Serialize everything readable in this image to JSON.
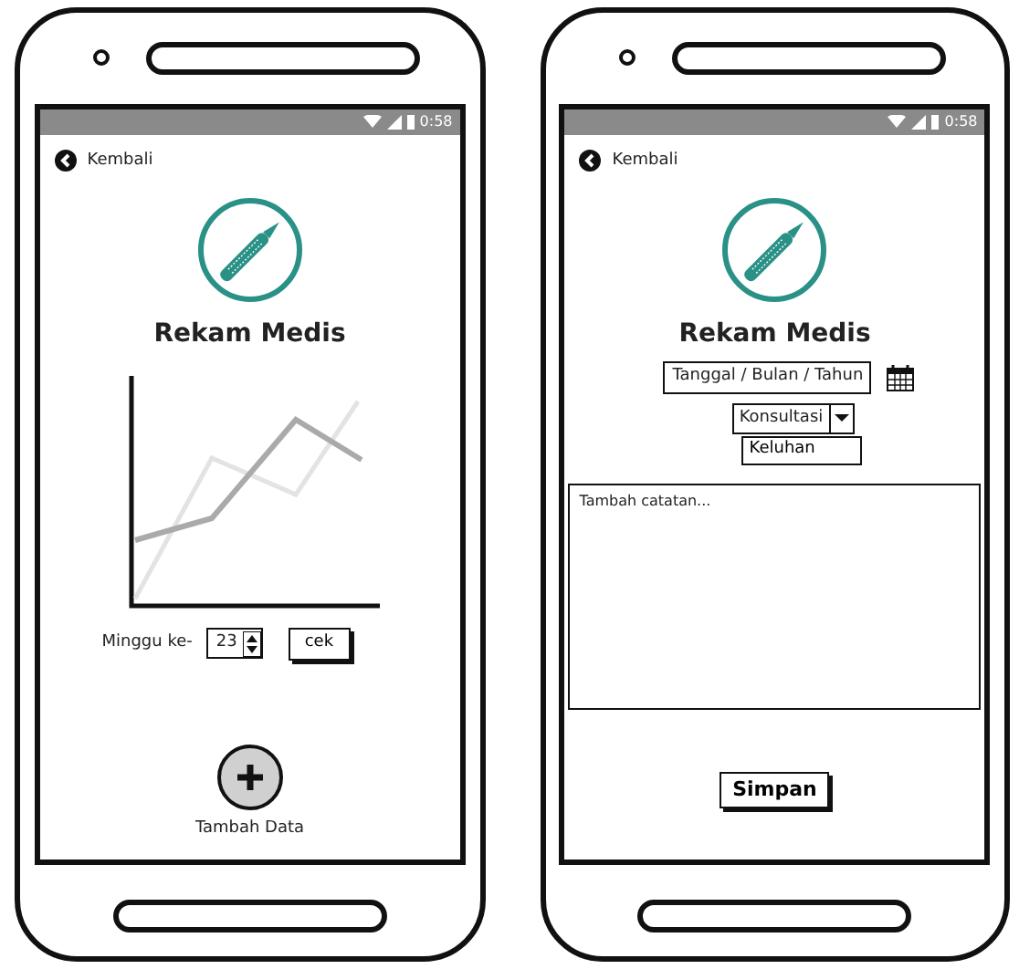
{
  "phones": [
    {
      "kind": "chart",
      "status_time": "0:58",
      "back_label": "Kembali",
      "title": "Rekam Medis",
      "week_label": "Minggu ke-",
      "week_value": "23",
      "check_button": "cek",
      "add_label": "Tambah Data"
    },
    {
      "kind": "form",
      "status_time": "0:58",
      "back_label": "Kembali",
      "title": "Rekam Medis",
      "date_placeholder": "Tanggal / Bulan / Tahun",
      "type_value": "Konsultasi",
      "complaint_value": "Keluhan",
      "notes_placeholder": "Tambah catatan...",
      "save_button": "Simpan"
    }
  ]
}
